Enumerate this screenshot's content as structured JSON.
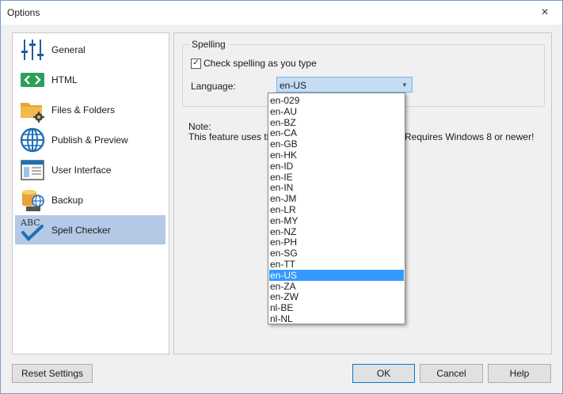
{
  "window": {
    "title": "Options",
    "close_glyph": "×"
  },
  "nav": {
    "items": [
      {
        "label": "General",
        "icon": "sliders-icon"
      },
      {
        "label": "HTML",
        "icon": "code-brackets-icon"
      },
      {
        "label": "Files & Folders",
        "icon": "folder-gear-icon"
      },
      {
        "label": "Publish & Preview",
        "icon": "globe-icon"
      },
      {
        "label": "User Interface",
        "icon": "window-layout-icon"
      },
      {
        "label": "Backup",
        "icon": "database-globe-icon"
      },
      {
        "label": "Spell Checker",
        "icon": "abc-checkmark-icon",
        "selected": true
      }
    ]
  },
  "spelling": {
    "group_title": "Spelling",
    "check_as_you_type_label": "Check spelling as you type",
    "check_as_you_type_checked": true,
    "language_label": "Language:",
    "language_value": "en-US"
  },
  "note": {
    "title": "Note:",
    "text_left": "This feature uses th",
    "text_right": "Requires Windows 8 or newer!"
  },
  "language_options": [
    "en-029",
    "en-AU",
    "en-BZ",
    "en-CA",
    "en-GB",
    "en-HK",
    "en-ID",
    "en-IE",
    "en-IN",
    "en-JM",
    "en-LR",
    "en-MY",
    "en-NZ",
    "en-PH",
    "en-SG",
    "en-TT",
    "en-US",
    "en-ZA",
    "en-ZW",
    "nl-BE",
    "nl-NL"
  ],
  "buttons": {
    "reset": "Reset Settings",
    "ok": "OK",
    "cancel": "Cancel",
    "help": "Help"
  },
  "colors": {
    "selected_nav_bg": "#b4c9e6",
    "dropdown_selection": "#3399ff",
    "icon_blue": "#1f6fb5",
    "icon_green": "#2e9e5b",
    "icon_folder": "#e8a33a"
  }
}
